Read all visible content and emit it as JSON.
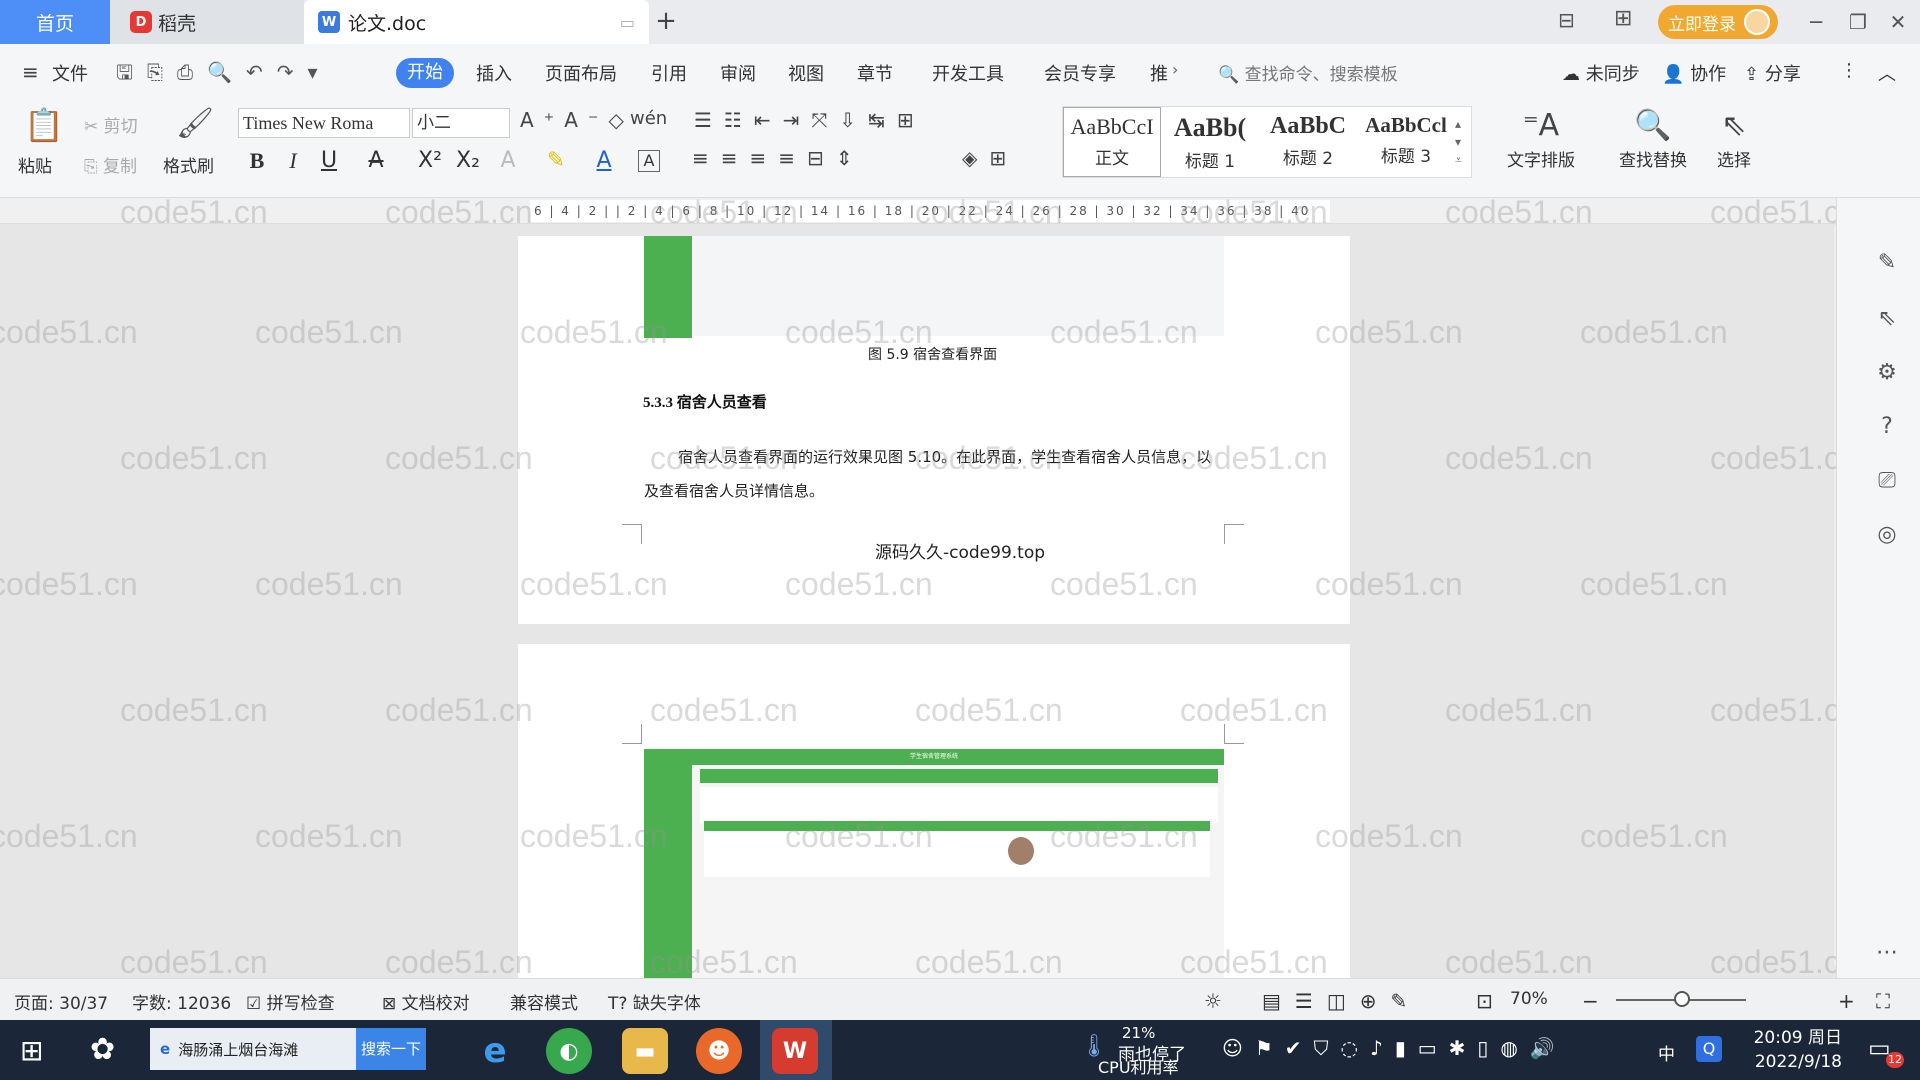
{
  "titlebar": {
    "tab_home": "首页",
    "tab_docer": "稻壳",
    "tab_doc": "论文.doc",
    "login": "立即登录"
  },
  "menu": {
    "file": "文件",
    "items": [
      "开始",
      "插入",
      "页面布局",
      "引用",
      "审阅",
      "视图",
      "章节",
      "开发工具",
      "会员专享",
      "推"
    ],
    "search_placeholder": "查找命令、搜索模板",
    "sync": "未同步",
    "collab": "协作",
    "share": "分享"
  },
  "ribbon": {
    "paste": "粘贴",
    "cut": "剪切",
    "copy": "复制",
    "format_painter": "格式刷",
    "font_name": "Times New Roma",
    "font_size": "小二",
    "styles": [
      {
        "sample": "AaBbCcI",
        "name": "正文"
      },
      {
        "sample": "AaBb(",
        "name": "标题 1"
      },
      {
        "sample": "AaBbC",
        "name": "标题 2"
      },
      {
        "sample": "AaBbCcl",
        "name": "标题 3"
      }
    ],
    "text_layout": "文字排版",
    "find_replace": "查找替换",
    "select": "选择"
  },
  "ruler": {
    "ticks": "6 | 4 | 2 |   | 2 | 4 | 6 | 8 | 10 | 12 | 14 | 16 | 18 | 20 | 22 | 24 | 26 | 28 | 30 | 32 | 34 | 36 | 38 | 40"
  },
  "document": {
    "figure_caption": "图 5.9  宿舍查看界面",
    "section_heading": "5.3.3  宿舍人员查看",
    "paragraph": "宿舍人员查看界面的运行效果见图 5.10。在此界面，学生查看宿舍人员信息，以及查看宿舍人员详情信息。",
    "footer": "源码久久-code99.top",
    "embedded_title": "学生宿舍管理系统"
  },
  "watermark": "code51.cn",
  "status": {
    "page": "页面: 30/37",
    "words": "字数: 12036",
    "spellcheck": "拼写检查",
    "proof": "文档校对",
    "compat": "兼容模式",
    "missing_font": "缺失字体",
    "zoom": "70%"
  },
  "taskbar": {
    "search_text": "海肠涌上烟台海滩",
    "search_btn": "搜索一下",
    "cpu_percent": "21%",
    "cpu_label": "CPU利用率",
    "news": "雨也停了",
    "ime": "中",
    "time": "20:09 周日",
    "date": "2022/9/18",
    "notif_count": "12"
  }
}
